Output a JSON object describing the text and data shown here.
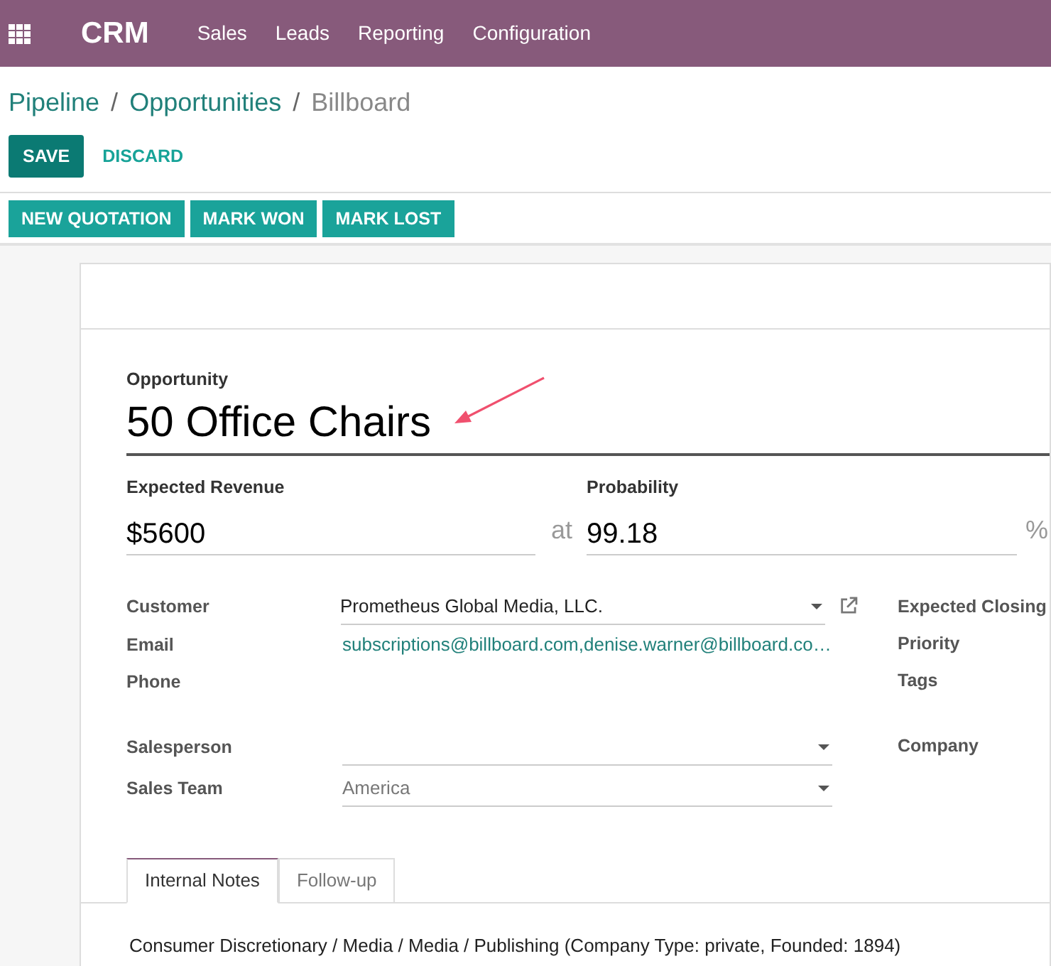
{
  "navbar": {
    "app": "CRM",
    "menu": [
      "Sales",
      "Leads",
      "Reporting",
      "Configuration"
    ]
  },
  "breadcrumb": [
    {
      "label": "Pipeline",
      "link": true
    },
    {
      "label": "Opportunities",
      "link": true
    },
    {
      "label": "Billboard",
      "link": false
    }
  ],
  "breadcrumb_separators": [
    "/",
    "/"
  ],
  "edit_buttons": [
    {
      "label": "SAVE",
      "kind": "primary"
    },
    {
      "label": "DISCARD",
      "kind": "link"
    }
  ],
  "action_buttons": [
    "NEW QUOTATION",
    "MARK WON",
    "MARK LOST"
  ],
  "opportunity": {
    "label": "Opportunity",
    "value": "50 Office Chairs"
  },
  "revenue": {
    "label": "Expected Revenue",
    "value": "$5600",
    "joiner": "at"
  },
  "probability": {
    "label": "Probability",
    "value": "99.18",
    "unit": "%"
  },
  "left_fields": [
    {
      "label": "Customer",
      "value": "Prometheus Global Media, LLC.",
      "kind": "dropdown",
      "external_link": true
    },
    {
      "label": "Email",
      "value": "subscriptions@billboard.com,denise.warner@billboard.co…",
      "kind": "link"
    },
    {
      "label": "Phone",
      "kind": "empty"
    },
    {
      "label": "Salesperson",
      "kind": "dropdown",
      "external_link": false
    },
    {
      "label": "Sales Team",
      "value": "America",
      "kind": "dropdown",
      "external_link": false,
      "muted": true
    }
  ],
  "right_fields": [
    "Expected Closing",
    "Priority",
    "Tags",
    "Company"
  ],
  "tabs": [
    {
      "label": "Internal Notes",
      "selected": true
    },
    {
      "label": "Follow-up",
      "selected": false
    }
  ],
  "notes": "Consumer Discretionary / Media / Media / Publishing (Company Type: private, Founded: 1894)"
}
